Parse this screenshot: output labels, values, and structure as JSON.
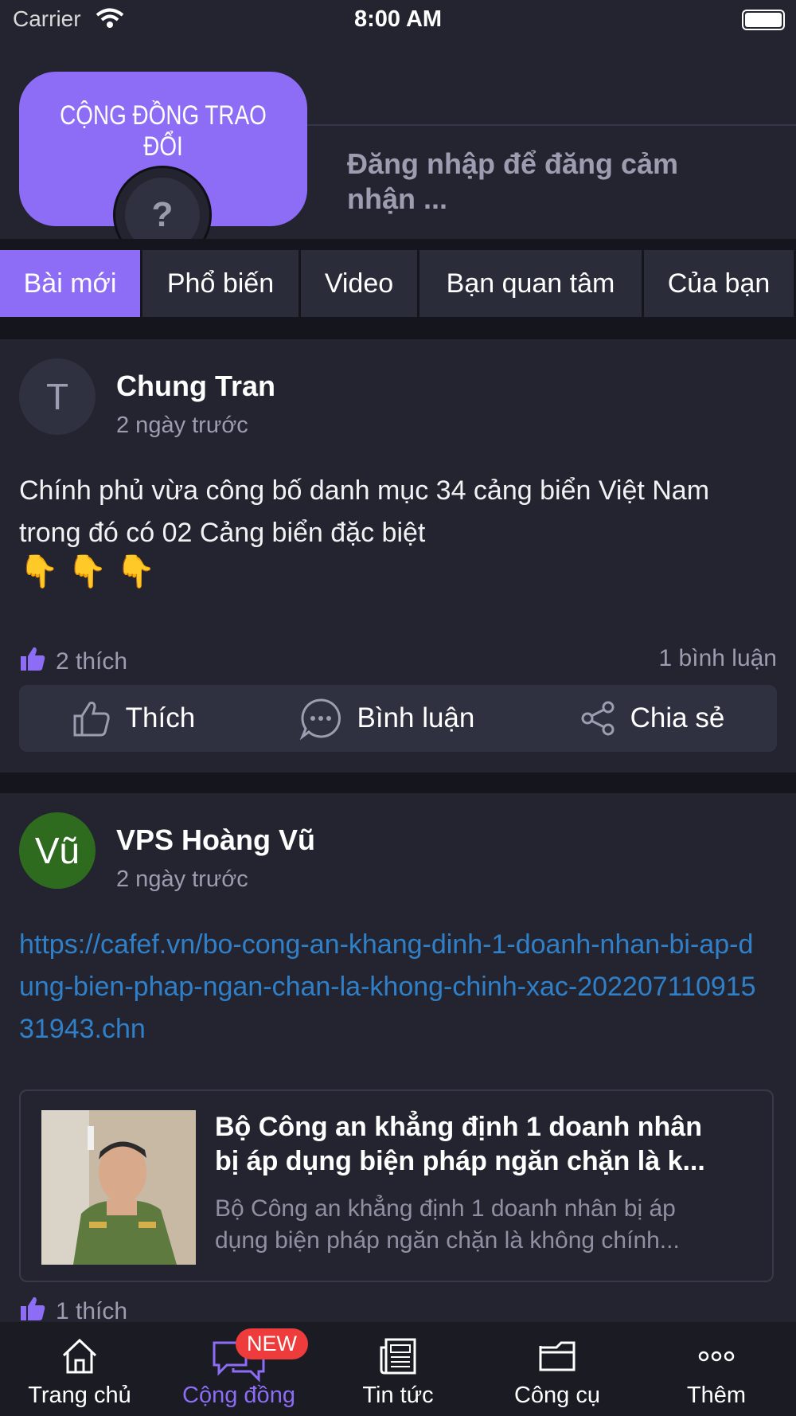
{
  "status_bar": {
    "carrier": "Carrier",
    "time": "8:00 AM"
  },
  "header": {
    "community_title": "CỘNG ĐỒNG TRAO ĐỔI",
    "avatar_placeholder": "?",
    "login_prompt": "Đăng nhập để đăng cảm nhận ..."
  },
  "tabs": [
    {
      "label": "Bài mới",
      "active": true
    },
    {
      "label": "Phổ biến",
      "active": false
    },
    {
      "label": "Video",
      "active": false
    },
    {
      "label": "Bạn quan tâm",
      "active": false
    },
    {
      "label": "Của bạn",
      "active": false
    }
  ],
  "posts": [
    {
      "avatar_letter": "T",
      "avatar_color": "#2f3140",
      "author": "Chung Tran",
      "time": "2 ngày trước",
      "content": "Chính phủ vừa công bố danh mục 34 cảng biển Việt Nam trong đó có 02 Cảng biển đặc biệt",
      "emoji": "👇 👇 👇",
      "likes": "2 thích",
      "comments": "1 bình luận",
      "actions": {
        "like": "Thích",
        "comment": "Bình luận",
        "share": "Chia sẻ"
      }
    },
    {
      "avatar_letter": "Vũ",
      "avatar_color": "#2e6b1f",
      "author": "VPS Hoàng Vũ",
      "time": "2 ngày trước",
      "link": "https://cafef.vn/bo-cong-an-khang-dinh-1-doanh-nhan-bi-ap-dung-bien-phap-ngan-chan-la-khong-chinh-xac-20220711091531943.chn",
      "preview": {
        "title_line1": "Bộ Công an khẳng định 1 doanh nhân",
        "title_line2": "bị áp dụng biện pháp ngăn chặn là k...",
        "desc_line1": "Bộ Công an khẳng định 1 doanh nhân bị áp",
        "desc_line2": "dụng biện pháp ngăn chặn là không chính..."
      },
      "likes": "1 thích"
    }
  ],
  "bottom_nav": [
    {
      "label": "Trang chủ",
      "icon": "home-icon",
      "active": false
    },
    {
      "label": "Cộng đồng",
      "icon": "chat-icon",
      "active": true,
      "badge": "NEW"
    },
    {
      "label": "Tin tức",
      "icon": "newspaper-icon",
      "active": false
    },
    {
      "label": "Công cụ",
      "icon": "folder-icon",
      "active": false
    },
    {
      "label": "Thêm",
      "icon": "more-icon",
      "active": false
    }
  ],
  "colors": {
    "accent": "#8d6cf6",
    "background": "#23242f",
    "link": "#2f80c8",
    "badge": "#ee3b3b"
  }
}
